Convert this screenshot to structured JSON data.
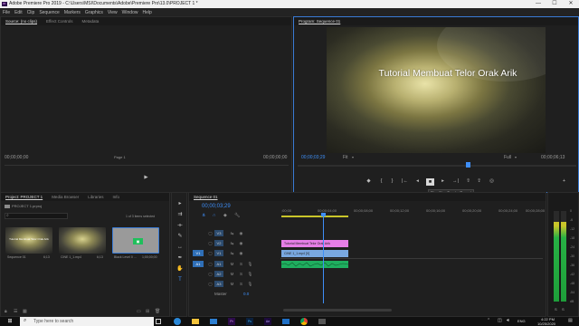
{
  "window": {
    "title": "Adobe Premiere Pro 2019 - C:\\Users\\MSI\\Documents\\Adobe\\Premiere Pro\\13.0\\PROJECT 1 *",
    "controls": [
      "—",
      "☐",
      "✕"
    ]
  },
  "menu": [
    "File",
    "Edit",
    "Clip",
    "Sequence",
    "Markers",
    "Graphics",
    "View",
    "Window",
    "Help"
  ],
  "source_panel": {
    "tabs": [
      "Source: (no clips)",
      "Effect Controls",
      "Metadata"
    ],
    "timecode_left": "00;00;00;00",
    "page": "Page 1",
    "timecode_right": "00;00;00;00"
  },
  "program_panel": {
    "tab": "Program: Sequence 01",
    "overlay_text": "Tutorial Membuat Telor Orak Arik",
    "timecode_current": "00;00;03;29",
    "fit": "Fit",
    "quality": "Full",
    "timecode_duration": "00;00;06;13",
    "tooltip": "Play-Stop Toggle (Space)"
  },
  "project_panel": {
    "tabs": [
      "Project: PROJECT 1",
      "Media Browser",
      "Libraries",
      "Info"
    ],
    "project_file": "PROJECT 1.prproj",
    "selection": "1 of 3 items selected",
    "items": [
      {
        "name": "Sequence 01",
        "duration": "6;13",
        "thumb_text": "Tutorial Membuat Telor Orak Arik"
      },
      {
        "name": "CINE 1_1.mp4",
        "duration": "6;13"
      },
      {
        "name": "Black Level 0 ...",
        "duration": "1;00;00;00"
      }
    ]
  },
  "timeline": {
    "tab": "Sequence 01",
    "timecode": "00;00;03;29",
    "ruler": [
      ";00;00",
      "00;00;04;00",
      "00;00;08;00",
      "00;00;12;00",
      "00;00;16;00",
      "00;00;20;00",
      "00;00;24;00",
      "00;00;28;00",
      "00;00;32;00"
    ],
    "video_tracks": [
      {
        "label": "V3"
      },
      {
        "label": "V2"
      },
      {
        "label": "V1",
        "source": "V1"
      }
    ],
    "audio_tracks": [
      {
        "label": "A1",
        "source": "A1"
      },
      {
        "label": "A2"
      },
      {
        "label": "A3"
      }
    ],
    "master": {
      "label": "Master",
      "value": "0.0"
    },
    "clips": {
      "v2": "Tutorial Membuat Telor Orak Arik",
      "v1": "CINE 1_1.mp4 [V]"
    }
  },
  "meter": {
    "ticks": [
      "0",
      "-6",
      "-12",
      "-18",
      "-24",
      "-30",
      "-36",
      "-42",
      "-48",
      "-54",
      "dB"
    ],
    "solo": [
      "S",
      "S"
    ]
  },
  "taskbar": {
    "search_placeholder": "Type here to search",
    "apps": [
      "task-view-icon",
      "edge-icon",
      "explorer-icon",
      "store-icon",
      "premiere-icon",
      "photoshop-icon",
      "after-effects-icon",
      "mail-icon",
      "chrome-icon",
      "camera-icon"
    ],
    "lang": "ENG",
    "time": "4:22 PM",
    "date": "10/25/2020"
  },
  "colors": {
    "accent": "#3e8ef7",
    "playhead": "#3e8ef7",
    "clip_pink": "#e67ee6",
    "clip_blue": "#79a8e0",
    "audio_green": "#1fae5f"
  }
}
